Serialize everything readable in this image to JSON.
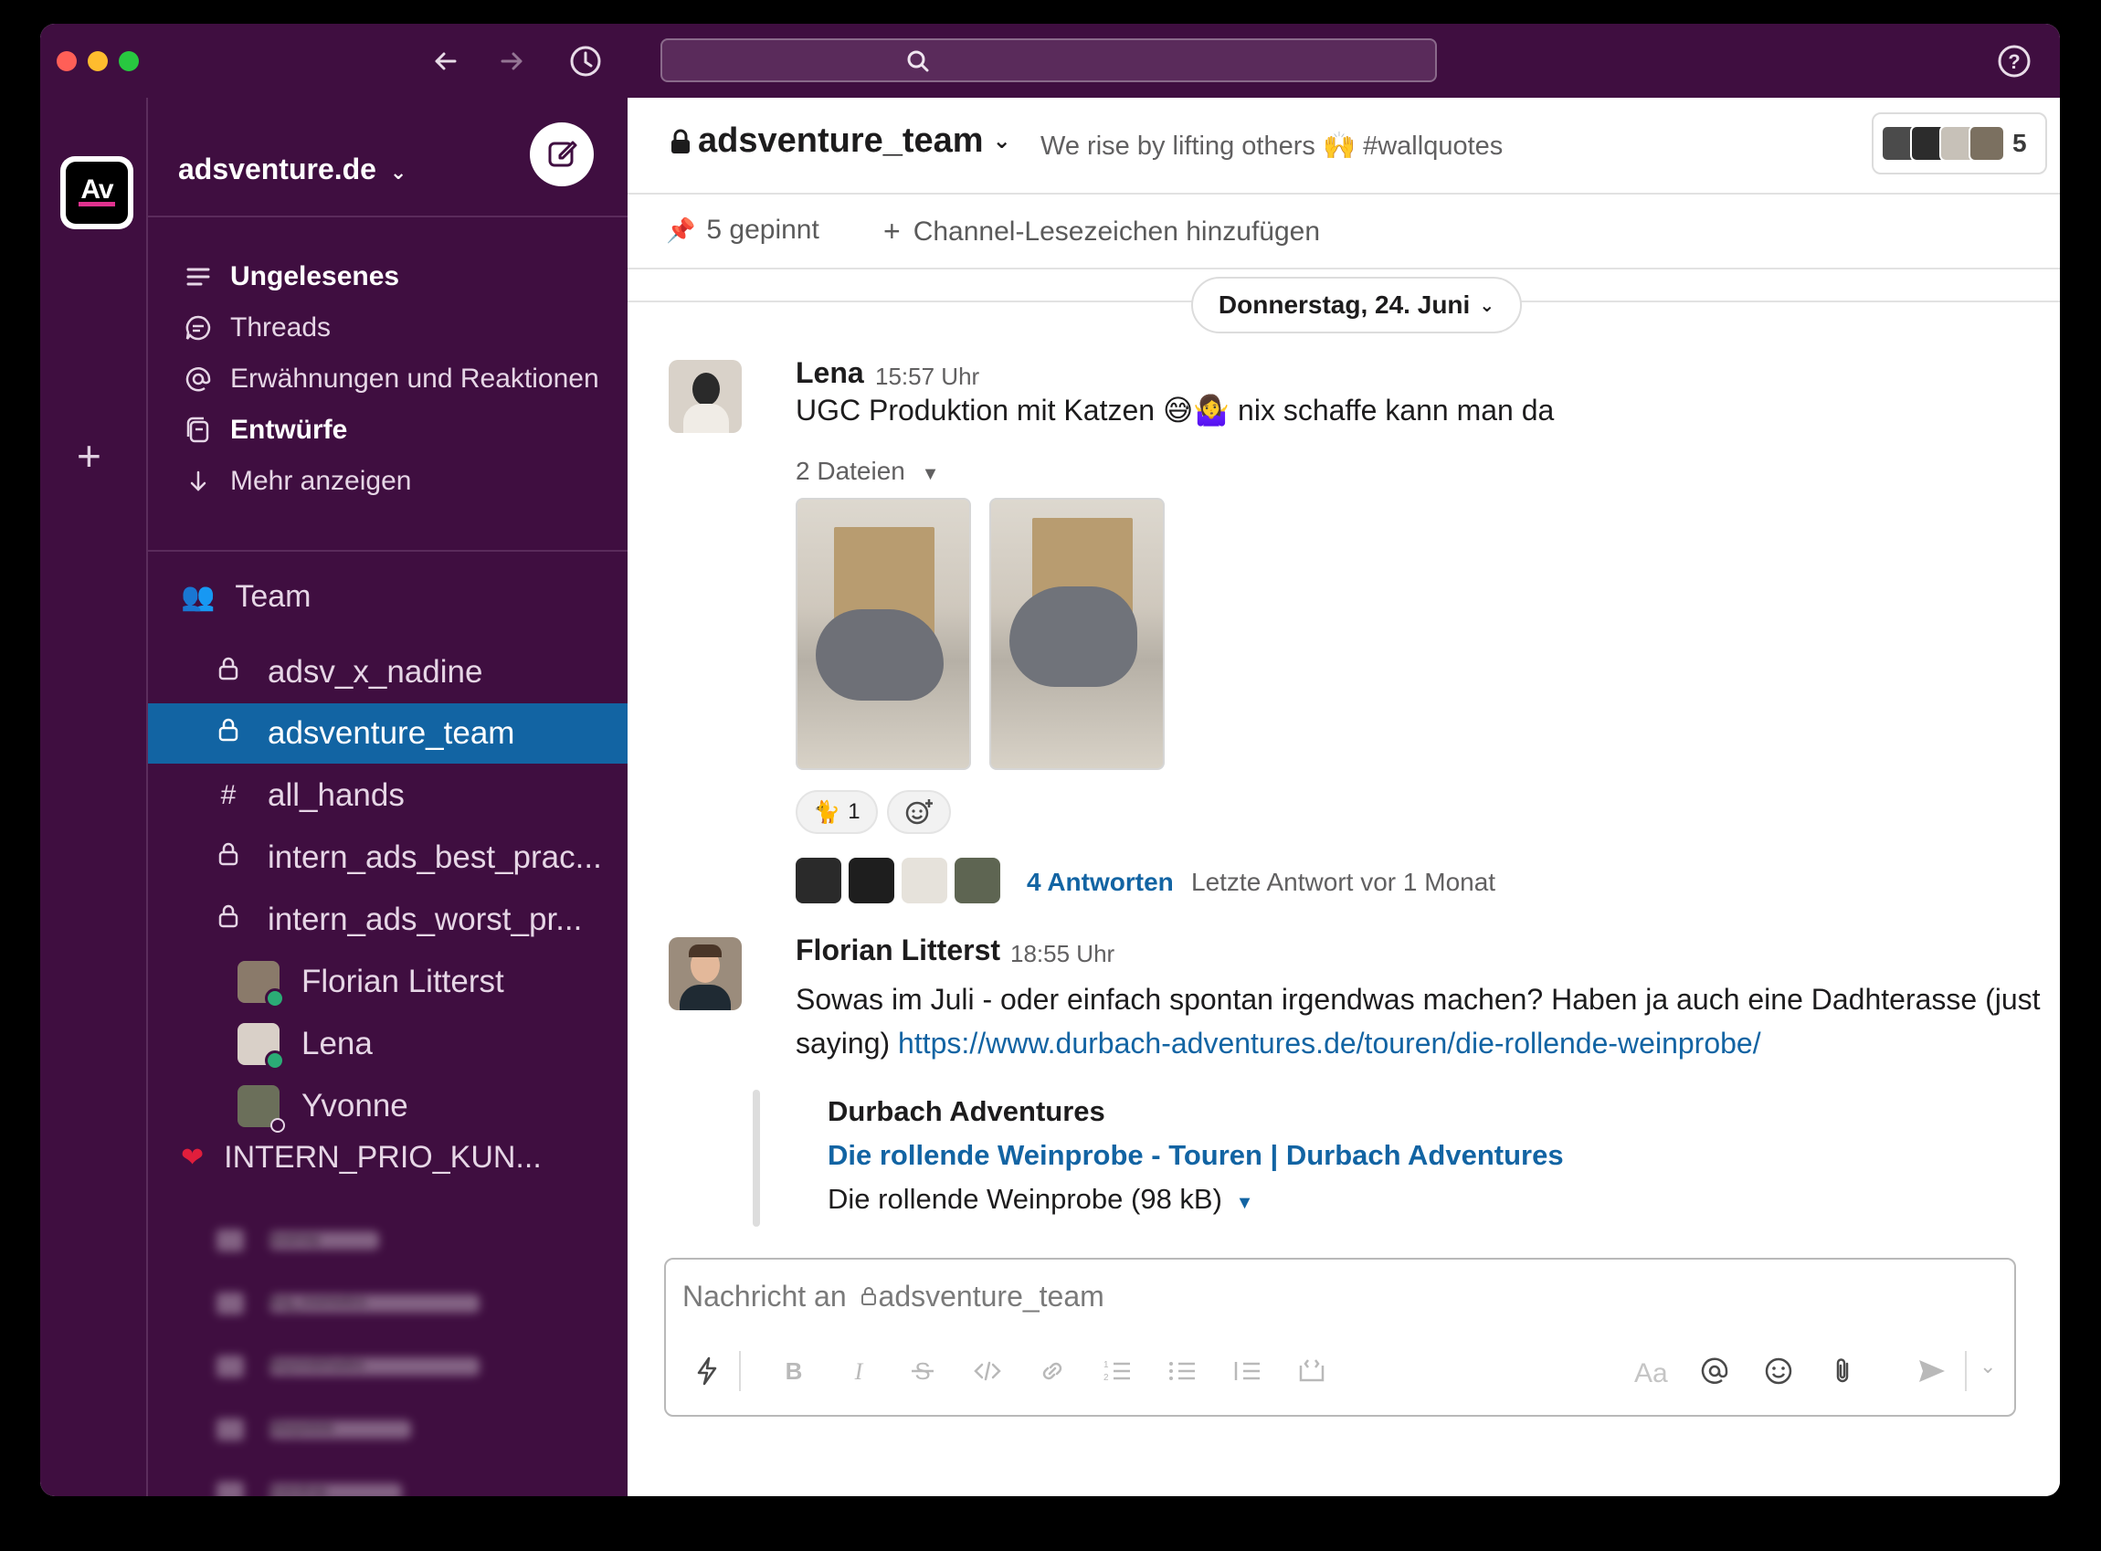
{
  "window": {
    "traffic_lights": [
      "#ff5f57",
      "#febc2e",
      "#28c840"
    ],
    "search_placeholder": ""
  },
  "workspace": {
    "logo_text": "Av",
    "name": "adsventure.de"
  },
  "sidebar": {
    "nav": [
      {
        "label": "Ungelesenes",
        "icon": "unread-icon",
        "bold": true
      },
      {
        "label": "Threads",
        "icon": "threads-icon",
        "bold": false
      },
      {
        "label": "Erwähnungen und Reaktionen",
        "icon": "at-icon",
        "bold": false
      },
      {
        "label": "Entwürfe",
        "icon": "drafts-icon",
        "bold": true
      },
      {
        "label": "Mehr anzeigen",
        "icon": "arrow-down-icon",
        "bold": false
      }
    ],
    "section_team": "Team",
    "channels": [
      {
        "label": "adsv_x_nadine",
        "icon": "lock-icon"
      },
      {
        "label": "adsventure_team",
        "icon": "lock-icon",
        "active": true
      },
      {
        "label": "all_hands",
        "icon": "hash-icon"
      },
      {
        "label": "intern_ads_best_prac...",
        "icon": "lock-icon"
      },
      {
        "label": "intern_ads_worst_pr...",
        "icon": "lock-icon"
      }
    ],
    "dms": [
      {
        "label": "Florian Litterst",
        "status": "online"
      },
      {
        "label": "Lena",
        "status": "online"
      },
      {
        "label": "Yvonne",
        "status": "away"
      }
    ],
    "section_prio": "INTERN_PRIO_KUN...",
    "blurred_channels": [
      "avamay",
      "bcg_cosmetics",
      "beyondshades",
      "ebepetete",
      "everdrop"
    ]
  },
  "header": {
    "channel": "adsventure_team",
    "topic_a": "We rise by lifting others",
    "topic_b": "#wallquotes",
    "member_count": "5",
    "pinned": "5 gepinnt",
    "bookmark": "Channel-Lesezeichen hinzufügen"
  },
  "date_divider": "Donnerstag, 24. Juni",
  "messages": [
    {
      "author": "Lena",
      "time": "15:57 Uhr",
      "text_a": "UGC Produktion mit Katzen",
      "text_b": "nix schaffe kann man da",
      "files_label": "2 Dateien",
      "reaction_count": "1",
      "replies": "4 Antworten",
      "last_reply": "Letzte Antwort vor 1 Monat"
    },
    {
      "author": "Florian Litterst",
      "time": "18:55 Uhr",
      "text_line1": "Sowas im Juli - oder einfach spontan irgendwas machen? Haben ja auch eine Dadhterasse (just",
      "text_line2_prefix": "saying)",
      "link": "https://www.durbach-adventures.de/touren/die-rollende-weinprobe/",
      "unfurl": {
        "site": "Durbach Adventures",
        "title": "Die rollende Weinprobe - Touren | Durbach Adventures",
        "file": "Die rollende Weinprobe (98 kB)"
      }
    }
  ],
  "composer": {
    "placeholder_prefix": "Nachricht an",
    "placeholder_channel": "adsventure_team",
    "format_label": "Aa"
  },
  "colors": {
    "sidebar_bg": "#3f0e40",
    "active_channel": "#1264a3",
    "link": "#1264a3",
    "online": "#2bac76"
  }
}
